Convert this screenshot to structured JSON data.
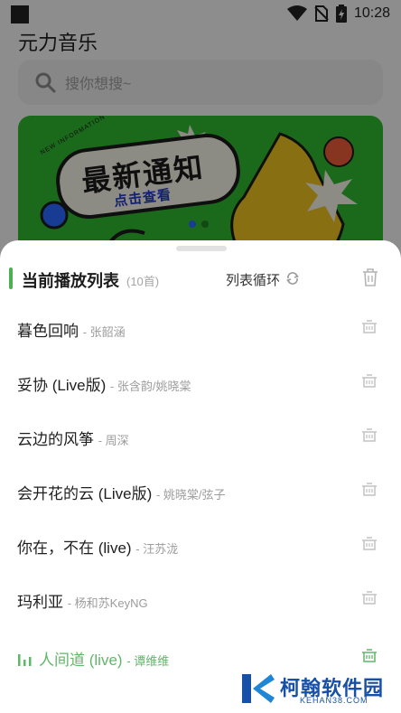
{
  "status_bar": {
    "time": "10:28"
  },
  "app": {
    "title": "元力音乐",
    "search_placeholder": "搜你想搜~"
  },
  "banner": {
    "title": "最新通知",
    "subtitle": "点击查看",
    "tag": "NEW INFORMATION"
  },
  "playlist": {
    "title": "当前播放列表",
    "count": "(10首)",
    "mode_label": "列表循环",
    "accent_color": "#4caf50",
    "songs": [
      {
        "name": "暮色回响",
        "artist": "- 张韶涵",
        "playing": false
      },
      {
        "name": "妥协 (Live版)",
        "artist": "- 张含韵/姚晓棠",
        "playing": false
      },
      {
        "name": "云边的风筝",
        "artist": "- 周深",
        "playing": false
      },
      {
        "name": "会开花的云 (Live版)",
        "artist": "- 姚晓棠/弦子",
        "playing": false
      },
      {
        "name": "你在，不在 (live)",
        "artist": "- 汪苏泷",
        "playing": false
      },
      {
        "name": "玛利亚",
        "artist": "- 杨和苏KeyNG",
        "playing": false
      },
      {
        "name": "人间道 (live)",
        "artist": "- 谭维维",
        "playing": true
      }
    ]
  },
  "watermark": {
    "text": "柯翰软件园",
    "sub": "KEHAN38.COM"
  }
}
